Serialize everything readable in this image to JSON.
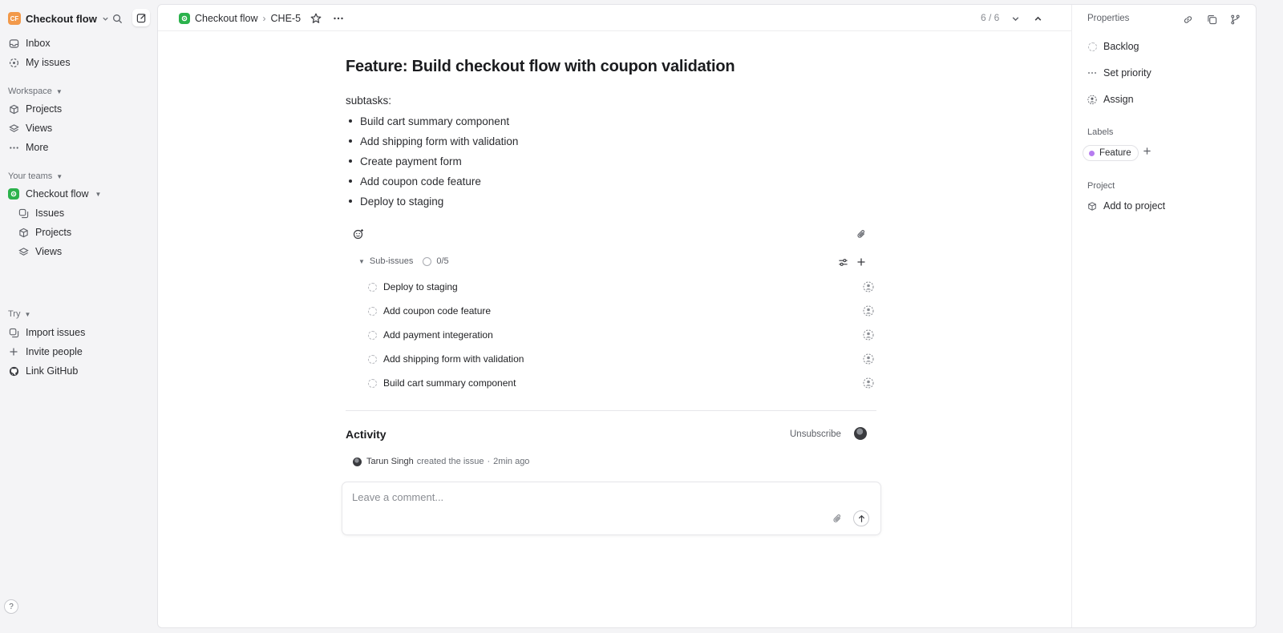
{
  "sidebar": {
    "workspace": {
      "initials": "CF",
      "name": "Checkout flow"
    },
    "top_items": [
      {
        "label": "Inbox",
        "icon": "inbox-icon"
      },
      {
        "label": "My issues",
        "icon": "target-icon"
      }
    ],
    "workspace_section": {
      "label": "Workspace",
      "items": [
        {
          "label": "Projects",
          "icon": "cube-icon"
        },
        {
          "label": "Views",
          "icon": "layers-icon"
        },
        {
          "label": "More",
          "icon": "more-dots-icon"
        }
      ]
    },
    "teams_section": {
      "label": "Your teams",
      "team": {
        "label": "Checkout flow",
        "icon": "team-gear-icon"
      },
      "items": [
        {
          "label": "Issues",
          "icon": "issues-copy-icon"
        },
        {
          "label": "Projects",
          "icon": "cube-icon"
        },
        {
          "label": "Views",
          "icon": "layers-icon"
        }
      ]
    },
    "try_section": {
      "label": "Try",
      "items": [
        {
          "label": "Import issues",
          "icon": "import-icon"
        },
        {
          "label": "Invite people",
          "icon": "plus-icon"
        },
        {
          "label": "Link GitHub",
          "icon": "github-icon"
        }
      ]
    },
    "help_label": "?"
  },
  "topbar": {
    "team": "Checkout flow",
    "issue_id": "CHE-5",
    "pager": "6 / 6"
  },
  "issue": {
    "title": "Feature: Build checkout flow with coupon validation",
    "description_intro": "subtasks:",
    "description_bullets": [
      "Build cart summary component",
      "Add shipping form with validation",
      "Create payment form",
      "Add coupon code feature",
      "Deploy to staging"
    ]
  },
  "sub_issues": {
    "label": "Sub-issues",
    "progress": "0/5",
    "items": [
      {
        "title": "Deploy to staging"
      },
      {
        "title": "Add coupon code feature"
      },
      {
        "title": "Add payment integeration"
      },
      {
        "title": "Add shipping form with validation"
      },
      {
        "title": "Build cart summary component"
      }
    ]
  },
  "activity": {
    "title": "Activity",
    "unsubscribe": "Unsubscribe",
    "entry": {
      "user": "Tarun Singh",
      "action": "created the issue",
      "sep": "·",
      "time": "2min ago"
    }
  },
  "comment": {
    "placeholder": "Leave a comment..."
  },
  "properties": {
    "title": "Properties",
    "status": "Backlog",
    "priority": "Set priority",
    "assignee": "Assign",
    "labels_heading": "Labels",
    "labels": [
      {
        "name": "Feature",
        "color": "#b67cf0"
      }
    ],
    "project_heading": "Project",
    "project": "Add to project"
  },
  "colors": {
    "workspace_logo": "#f2994a",
    "team_icon": "#2bb24c",
    "feature_label": "#b67cf0"
  }
}
